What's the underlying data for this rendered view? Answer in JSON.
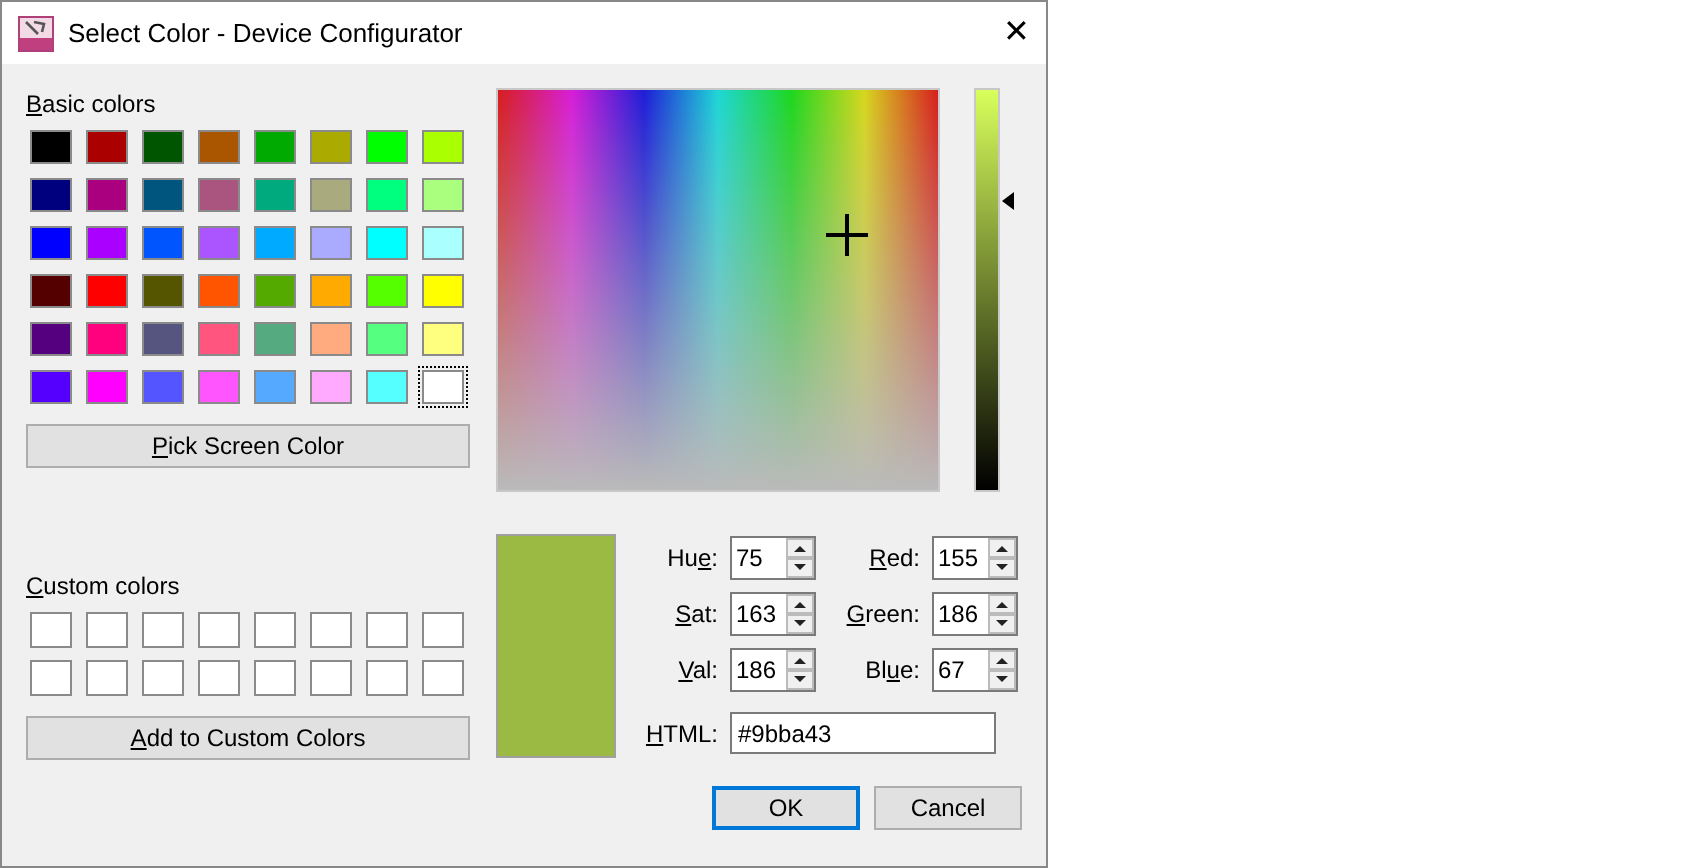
{
  "window": {
    "title": "Select Color - Device Configurator",
    "close": "✕"
  },
  "basic_colors": {
    "label": [
      {
        "text": "B",
        "underlined": true
      },
      {
        "text": "asic colors",
        "underlined": false
      }
    ],
    "swatches": [
      {
        "color": "#000000",
        "selected": false
      },
      {
        "color": "#aa0000",
        "selected": false
      },
      {
        "color": "#005500",
        "selected": false
      },
      {
        "color": "#aa5500",
        "selected": false
      },
      {
        "color": "#00aa00",
        "selected": false
      },
      {
        "color": "#aaaa00",
        "selected": false
      },
      {
        "color": "#00ff00",
        "selected": false
      },
      {
        "color": "#aaff00",
        "selected": false
      },
      {
        "color": "#00007f",
        "selected": false
      },
      {
        "color": "#aa007f",
        "selected": false
      },
      {
        "color": "#00557f",
        "selected": false
      },
      {
        "color": "#aa557f",
        "selected": false
      },
      {
        "color": "#00aa7f",
        "selected": false
      },
      {
        "color": "#aaaa7f",
        "selected": false
      },
      {
        "color": "#00ff7f",
        "selected": false
      },
      {
        "color": "#aaff7f",
        "selected": false
      },
      {
        "color": "#0000ff",
        "selected": false
      },
      {
        "color": "#aa00ff",
        "selected": false
      },
      {
        "color": "#0055ff",
        "selected": false
      },
      {
        "color": "#aa55ff",
        "selected": false
      },
      {
        "color": "#00aaff",
        "selected": false
      },
      {
        "color": "#aaaaff",
        "selected": false
      },
      {
        "color": "#00ffff",
        "selected": false
      },
      {
        "color": "#aaffff",
        "selected": false
      },
      {
        "color": "#550000",
        "selected": false
      },
      {
        "color": "#ff0000",
        "selected": false
      },
      {
        "color": "#555500",
        "selected": false
      },
      {
        "color": "#ff5500",
        "selected": false
      },
      {
        "color": "#55aa00",
        "selected": false
      },
      {
        "color": "#ffaa00",
        "selected": false
      },
      {
        "color": "#55ff00",
        "selected": false
      },
      {
        "color": "#ffff00",
        "selected": false
      },
      {
        "color": "#55007f",
        "selected": false
      },
      {
        "color": "#ff007f",
        "selected": false
      },
      {
        "color": "#55557f",
        "selected": false
      },
      {
        "color": "#ff557f",
        "selected": false
      },
      {
        "color": "#55aa7f",
        "selected": false
      },
      {
        "color": "#ffaa7f",
        "selected": false
      },
      {
        "color": "#55ff7f",
        "selected": false
      },
      {
        "color": "#ffff7f",
        "selected": false
      },
      {
        "color": "#5500ff",
        "selected": false
      },
      {
        "color": "#ff00ff",
        "selected": false
      },
      {
        "color": "#5555ff",
        "selected": false
      },
      {
        "color": "#ff55ff",
        "selected": false
      },
      {
        "color": "#55aaff",
        "selected": false
      },
      {
        "color": "#ffaaff",
        "selected": false
      },
      {
        "color": "#55ffff",
        "selected": false
      },
      {
        "color": "#ffffff",
        "selected": true
      }
    ]
  },
  "pick_screen_button": [
    {
      "text": "P",
      "underlined": true
    },
    {
      "text": "ick Screen Color",
      "underlined": false
    }
  ],
  "custom_colors": {
    "label": [
      {
        "text": "C",
        "underlined": true
      },
      {
        "text": "ustom colors",
        "underlined": false
      }
    ],
    "swatches": [
      {
        "color": "#ffffff"
      },
      {
        "color": "#ffffff"
      },
      {
        "color": "#ffffff"
      },
      {
        "color": "#ffffff"
      },
      {
        "color": "#ffffff"
      },
      {
        "color": "#ffffff"
      },
      {
        "color": "#ffffff"
      },
      {
        "color": "#ffffff"
      },
      {
        "color": "#ffffff"
      },
      {
        "color": "#ffffff"
      },
      {
        "color": "#ffffff"
      },
      {
        "color": "#ffffff"
      },
      {
        "color": "#ffffff"
      },
      {
        "color": "#ffffff"
      },
      {
        "color": "#ffffff"
      },
      {
        "color": "#ffffff"
      }
    ]
  },
  "add_custom_button": [
    {
      "text": "A",
      "underlined": true
    },
    {
      "text": "dd to Custom Colors",
      "underlined": false
    }
  ],
  "value_slider": {
    "level": 0.73
  },
  "preview": {
    "color": "#9bba43"
  },
  "fields": [
    {
      "label": [
        {
          "text": "Hu",
          "underlined": false
        },
        {
          "text": "e",
          "underlined": true
        },
        {
          "text": ":",
          "underlined": false
        }
      ],
      "value": "75"
    },
    {
      "label": [
        {
          "text": "R",
          "underlined": true
        },
        {
          "text": "ed:",
          "underlined": false
        }
      ],
      "value": "155"
    },
    {
      "label": [
        {
          "text": "S",
          "underlined": true
        },
        {
          "text": "at:",
          "underlined": false
        }
      ],
      "value": "163"
    },
    {
      "label": [
        {
          "text": "G",
          "underlined": true
        },
        {
          "text": "reen:",
          "underlined": false
        }
      ],
      "value": "186"
    },
    {
      "label": [
        {
          "text": "V",
          "underlined": true
        },
        {
          "text": "al:",
          "underlined": false
        }
      ],
      "value": "186"
    },
    {
      "label": [
        {
          "text": "Bl",
          "underlined": false
        },
        {
          "text": "u",
          "underlined": true
        },
        {
          "text": "e:",
          "underlined": false
        }
      ],
      "value": "67"
    }
  ],
  "html_field": {
    "label": [
      {
        "text": "H",
        "underlined": true
      },
      {
        "text": "TML:",
        "underlined": false
      }
    ],
    "value": "#9bba43"
  },
  "buttons": [
    {
      "label": "OK",
      "default": true
    },
    {
      "label": "Cancel",
      "default": false
    }
  ]
}
